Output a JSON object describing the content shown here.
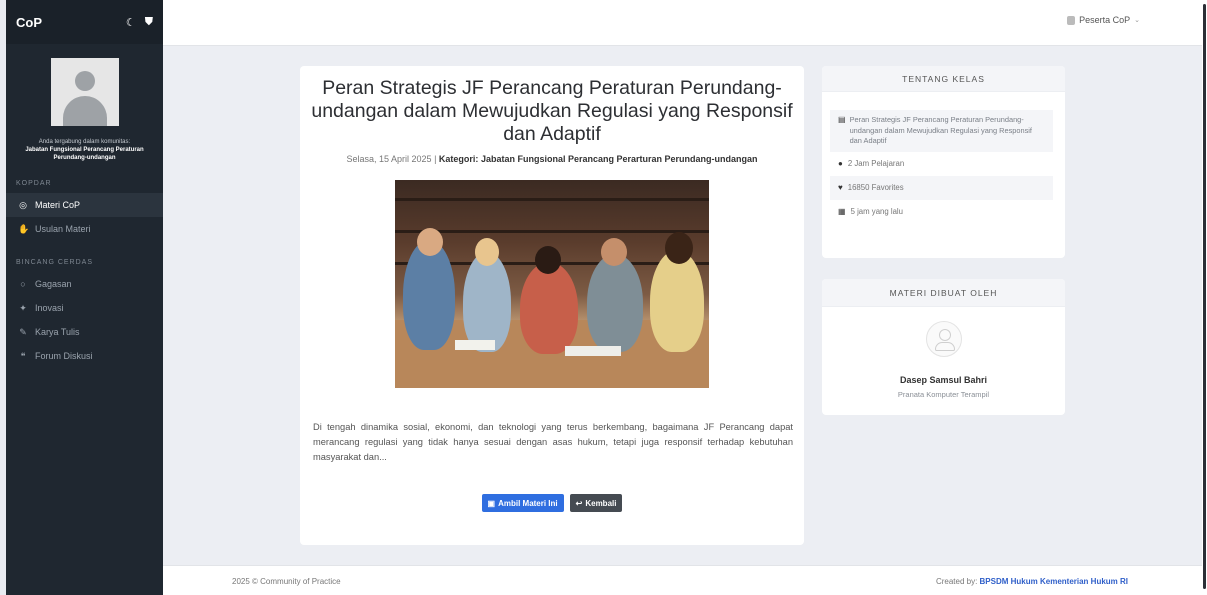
{
  "app": {
    "brand": "CoP",
    "moon_icon": "moon-icon",
    "bell_icon": "shield-icon"
  },
  "sidebar": {
    "join_text": "Anda tergabung dalam komunitas:",
    "community": "Jabatan Fungsional Perancang Peraturan Perundang-undangan",
    "sections": [
      {
        "title": "KOPDAR",
        "items": [
          {
            "label": "Materi CoP",
            "icon": "book-icon",
            "active": true
          },
          {
            "label": "Usulan Materi",
            "icon": "thumbs-up-icon",
            "active": false
          }
        ]
      },
      {
        "title": "BINCANG CERDAS",
        "items": [
          {
            "label": "Gagasan",
            "icon": "lightbulb-icon"
          },
          {
            "label": "Inovasi",
            "icon": "rocket-icon"
          },
          {
            "label": "Karya Tulis",
            "icon": "pen-icon"
          },
          {
            "label": "Forum Diskusi",
            "icon": "chat-icon"
          }
        ]
      }
    ]
  },
  "topbar": {
    "user_label": "Peserta CoP"
  },
  "article": {
    "title": "Peran Strategis JF Perancang Peraturan Perundang-undangan dalam Mewujudkan Regulasi yang Responsif dan Adaptif",
    "date": "Selasa, 15 April 2025",
    "category_prefix": "Kategori:",
    "category": "Jabatan Fungsional Perancang Perarturan Perundang-undangan",
    "description": "Di tengah dinamika sosial, ekonomi, dan teknologi yang terus berkembang, bagaimana JF Perancang dapat merancang regulasi yang tidak hanya sesuai dengan asas hukum, tetapi juga responsif terhadap kebutuhan masyarakat dan...",
    "take_button": "Ambil Materi Ini",
    "back_button": "Kembali"
  },
  "about": {
    "header": "TENTANG KELAS",
    "course_title": "Peran Strategis JF Perancang Peraturan Perundang-undangan dalam Mewujudkan Regulasi yang Responsif dan Adaptif",
    "hours": "2 Jam Pelajaran",
    "favorites": "16850 Favorites",
    "updated": "5 jam yang lalu"
  },
  "author": {
    "header": "MATERI DIBUAT OLEH",
    "name": "Dasep Samsul Bahri",
    "role": "Pranata Komputer Terampil"
  },
  "footer": {
    "left": "2025 © Community of Practice",
    "right_prefix": "Created by:",
    "right_org": "BPSDM Hukum Kementerian Hukum RI"
  }
}
